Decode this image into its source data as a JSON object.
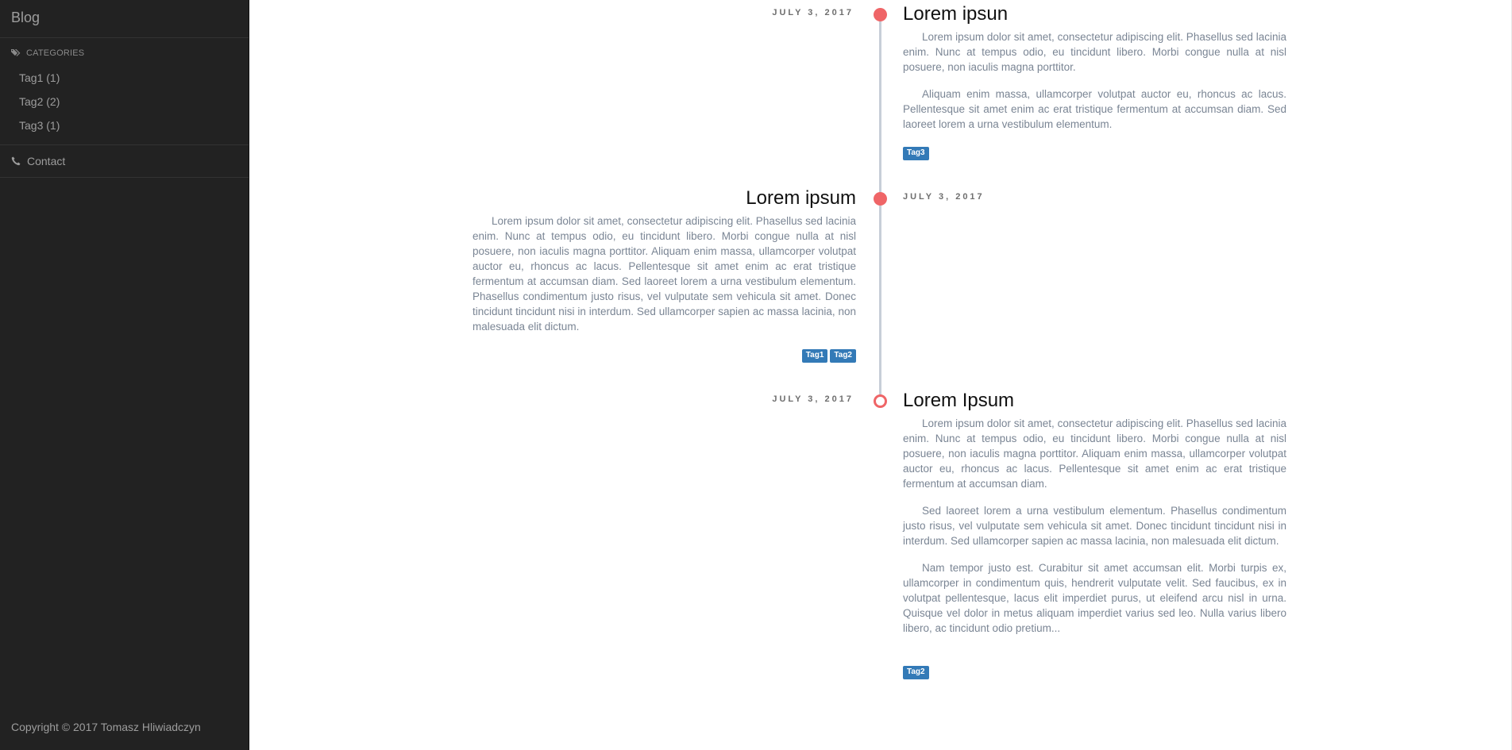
{
  "sidebar": {
    "brand": "Blog",
    "categories_label": "CATEGORIES",
    "categories": [
      {
        "label": "Tag1 (1)"
      },
      {
        "label": "Tag2 (2)"
      },
      {
        "label": "Tag3 (1)"
      }
    ],
    "contact_label": "Contact",
    "copyright": "Copyright © 2017 Tomasz Hliwiadczyn"
  },
  "colors": {
    "sidebar_bg": "#222222",
    "dot": "#ef6567",
    "tag_bg": "#337ab7",
    "timeline_line": "#c7ced8"
  },
  "posts": [
    {
      "date": "JULY 3, 2017",
      "title": "Lorem ipsun",
      "paragraphs": [
        "Lorem ipsum dolor sit amet, consectetur adipiscing elit. Phasellus sed lacinia enim. Nunc at tempus odio, eu tincidunt libero. Morbi congue nulla at nisl posuere, non iaculis magna porttitor.",
        "Aliquam enim massa, ullamcorper volutpat auctor eu, rhoncus ac lacus. Pellentesque sit amet enim ac erat tristique fermentum at accumsan diam. Sed laoreet lorem a urna vestibulum elementum."
      ],
      "tags": [
        "Tag3"
      ]
    },
    {
      "date": "JULY 3, 2017",
      "title": "Lorem ipsum",
      "paragraphs": [
        "Lorem ipsum dolor sit amet, consectetur adipiscing elit. Phasellus sed lacinia enim. Nunc at tempus odio, eu tincidunt libero. Morbi congue nulla at nisl posuere, non iaculis magna porttitor. Aliquam enim massa, ullamcorper volutpat auctor eu, rhoncus ac lacus. Pellentesque sit amet enim ac erat tristique fermentum at accumsan diam. Sed laoreet lorem a urna vestibulum elementum. Phasellus condimentum justo risus, vel vulputate sem vehicula sit amet. Donec tincidunt tincidunt nisi in interdum. Sed ullamcorper sapien ac massa lacinia, non malesuada elit dictum."
      ],
      "tags": [
        "Tag1",
        "Tag2"
      ]
    },
    {
      "date": "JULY 3, 2017",
      "title": "Lorem Ipsum",
      "paragraphs": [
        "Lorem ipsum dolor sit amet, consectetur adipiscing elit. Phasellus sed lacinia enim. Nunc at tempus odio, eu tincidunt libero. Morbi congue nulla at nisl posuere, non iaculis magna porttitor. Aliquam enim massa, ullamcorper volutpat auctor eu, rhoncus ac lacus. Pellentesque sit amet enim ac erat tristique fermentum at accumsan diam.",
        "Sed laoreet lorem a urna vestibulum elementum. Phasellus condimentum justo risus, vel vulputate sem vehicula sit amet. Donec tincidunt tincidunt nisi in interdum. Sed ullamcorper sapien ac massa lacinia, non malesuada elit dictum.",
        "Nam tempor justo est. Curabitur sit amet accumsan elit. Morbi turpis ex, ullamcorper in condimentum quis, hendrerit vulputate velit. Sed faucibus, ex in volutpat pellentesque, lacus elit imperdiet purus, ut eleifend arcu nisl in urna. Quisque vel dolor in metus aliquam imperdiet varius sed leo. Nulla varius libero libero, ac tincidunt odio pretium..."
      ],
      "tags": [
        "Tag2"
      ]
    }
  ]
}
